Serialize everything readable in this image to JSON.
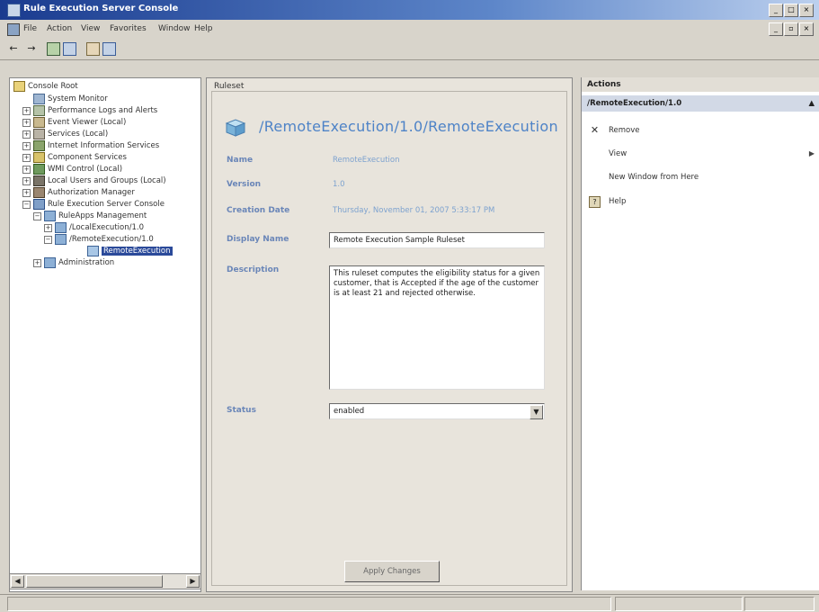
{
  "window": {
    "title": "Rule Execution Server Console"
  },
  "menu": [
    "File",
    "Action",
    "View",
    "Favorites",
    "Window",
    "Help"
  ],
  "tree": {
    "items": [
      {
        "label": "Console Root"
      },
      {
        "label": "System Monitor"
      },
      {
        "label": "Performance Logs and Alerts"
      },
      {
        "label": "Event Viewer (Local)"
      },
      {
        "label": "Services (Local)"
      },
      {
        "label": "Internet Information Services"
      },
      {
        "label": "Component Services"
      },
      {
        "label": "WMI Control (Local)"
      },
      {
        "label": "Local Users and Groups (Local)"
      },
      {
        "label": "Authorization Manager"
      },
      {
        "label": "Rule Execution Server Console"
      },
      {
        "label": "RuleApps Management"
      },
      {
        "label": "/LocalExecution/1.0"
      },
      {
        "label": "/RemoteExecution/1.0"
      },
      {
        "label": "RemoteExecution"
      },
      {
        "label": "Administration"
      }
    ]
  },
  "detail": {
    "section_label": "Ruleset",
    "path": "/RemoteExecution/1.0/RemoteExecution",
    "name_label": "Name",
    "name_value": "RemoteExecution",
    "version_label": "Version",
    "version_value": "1.0",
    "creation_label": "Creation Date",
    "creation_value": "Thursday, November 01, 2007 5:33:17 PM",
    "display_label": "Display Name",
    "display_value": "Remote Execution Sample Ruleset",
    "description_label": "Description",
    "description_value": "This ruleset computes the eligibility status for a given customer, that is Accepted if the age of the customer is at least 21 and rejected otherwise.",
    "status_label": "Status",
    "status_value": "enabled",
    "apply_label": "Apply Changes"
  },
  "actions": {
    "header": "Actions",
    "subheader": "/RemoteExecution/1.0",
    "items": [
      "Remove",
      "View",
      "New Window from Here",
      "Help"
    ]
  }
}
